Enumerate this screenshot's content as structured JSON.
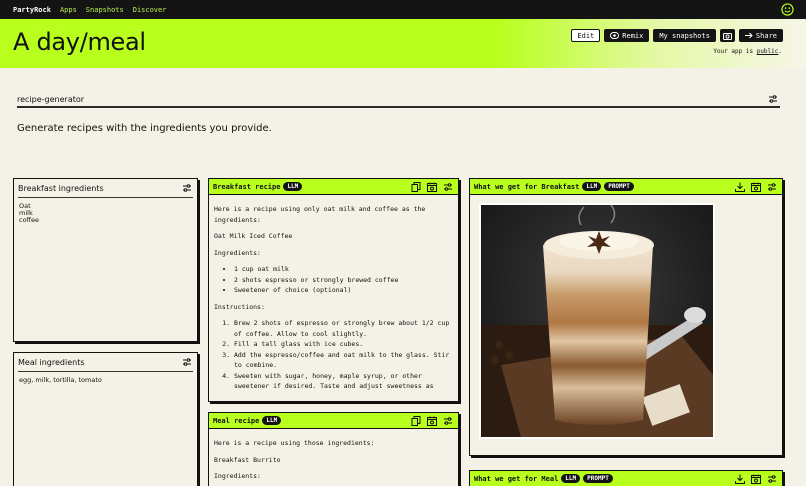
{
  "nav": {
    "brand": "PartyRock",
    "links": [
      "Apps",
      "Snapshots",
      "Discover"
    ]
  },
  "header": {
    "title": "A day/meal",
    "buttons": {
      "edit": "Edit",
      "remix": "Remix",
      "snapshots": "My snapshots",
      "share": "Share"
    },
    "public_prefix": "Your app is ",
    "public_link": "public",
    "public_suffix": "."
  },
  "generator": {
    "name": "recipe-generator",
    "description": "Generate recipes with the ingredients you provide."
  },
  "widgets": {
    "breakfast_ingredients": {
      "title": "Breakfast ingredients",
      "lines": [
        "Oat",
        "milk",
        "coffee"
      ]
    },
    "meal_ingredients": {
      "title": "Meal ingredients",
      "text": "egg, milk, tortilla, tomato"
    },
    "breakfast_recipe": {
      "title": "Breakfast recipe",
      "badge": "LLM",
      "intro": "Here is a recipe using only oat milk and coffee as the ingredients:",
      "name": "Oat Milk Iced Coffee",
      "ingredients_heading": "Ingredients:",
      "ingredients": [
        "1 cup oat milk",
        "2 shots espresso or strongly brewed coffee",
        "Sweetener of choice (optional)"
      ],
      "instructions_heading": "Instructions:",
      "instructions": [
        "Brew 2 shots of espresso or strongly brew about 1/2 cup of coffee. Allow to cool slightly.",
        "Fill a tall glass with ice cubes.",
        "Add the espresso/coffee and oat milk to the glass. Stir to combine.",
        "Sweeten with sugar, honey, maple syrup, or other sweetener if desired. Taste and adjust sweetness as"
      ]
    },
    "meal_recipe": {
      "title": "Meal recipe",
      "badge": "LLM",
      "intro": "Here is a recipe using those ingredients:",
      "name": "Breakfast Burrito",
      "ingredients_heading": "Ingredients:"
    },
    "breakfast_image": {
      "title": "What we get for Breakfast",
      "badges": [
        "LLM",
        "PROMPT"
      ]
    },
    "meal_image": {
      "title": "What we get for Meal",
      "badges": [
        "LLM",
        "PROMPT"
      ]
    }
  },
  "colors": {
    "accent": "#b8ff1e",
    "dark": "#141414",
    "background": "#f4f1e6"
  },
  "icons": [
    "smiley-icon",
    "camera-icon",
    "share-arrow-icon",
    "settings-sliders-icon",
    "copy-icon",
    "calendar-refresh-icon",
    "download-icon"
  ]
}
